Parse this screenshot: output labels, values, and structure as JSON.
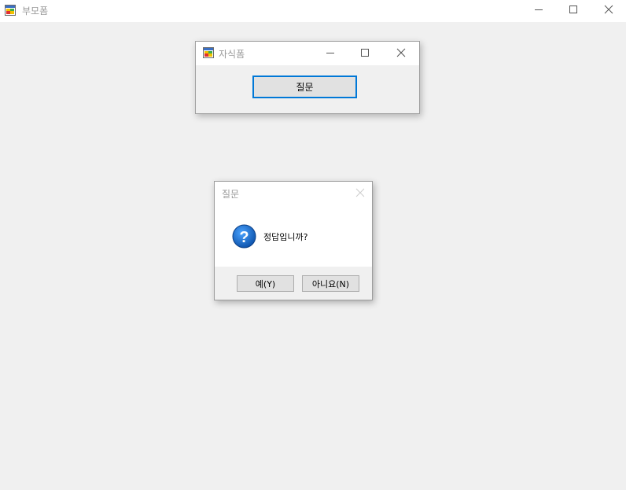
{
  "main_window": {
    "title": "부모폼"
  },
  "child_window": {
    "title": "자식폼",
    "button_label": "질문"
  },
  "message_box": {
    "title": "질문",
    "message": "정답입니까?",
    "icon": "question-icon",
    "buttons": {
      "yes": "예(Y)",
      "no": "아니요(N)"
    }
  },
  "colors": {
    "background": "#f0f0f0",
    "titlebar": "#ffffff",
    "accent_border": "#0078d7",
    "question_icon": "#1565c0"
  }
}
